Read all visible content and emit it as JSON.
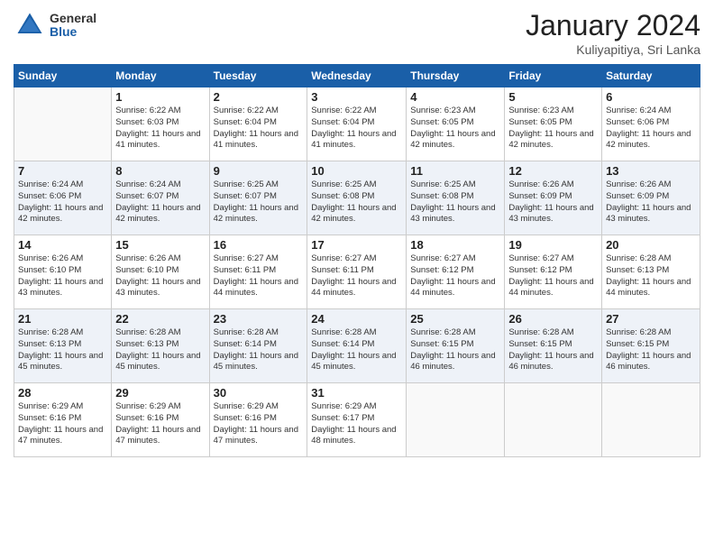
{
  "header": {
    "logo": {
      "general": "General",
      "blue": "Blue"
    },
    "title": "January 2024",
    "subtitle": "Kuliyapitiya, Sri Lanka"
  },
  "calendar": {
    "weekdays": [
      "Sunday",
      "Monday",
      "Tuesday",
      "Wednesday",
      "Thursday",
      "Friday",
      "Saturday"
    ],
    "rows": [
      [
        {
          "day": "",
          "empty": true
        },
        {
          "day": "1",
          "sunrise": "Sunrise: 6:22 AM",
          "sunset": "Sunset: 6:03 PM",
          "daylight": "Daylight: 11 hours and 41 minutes."
        },
        {
          "day": "2",
          "sunrise": "Sunrise: 6:22 AM",
          "sunset": "Sunset: 6:04 PM",
          "daylight": "Daylight: 11 hours and 41 minutes."
        },
        {
          "day": "3",
          "sunrise": "Sunrise: 6:22 AM",
          "sunset": "Sunset: 6:04 PM",
          "daylight": "Daylight: 11 hours and 41 minutes."
        },
        {
          "day": "4",
          "sunrise": "Sunrise: 6:23 AM",
          "sunset": "Sunset: 6:05 PM",
          "daylight": "Daylight: 11 hours and 42 minutes."
        },
        {
          "day": "5",
          "sunrise": "Sunrise: 6:23 AM",
          "sunset": "Sunset: 6:05 PM",
          "daylight": "Daylight: 11 hours and 42 minutes."
        },
        {
          "day": "6",
          "sunrise": "Sunrise: 6:24 AM",
          "sunset": "Sunset: 6:06 PM",
          "daylight": "Daylight: 11 hours and 42 minutes."
        }
      ],
      [
        {
          "day": "7",
          "sunrise": "Sunrise: 6:24 AM",
          "sunset": "Sunset: 6:06 PM",
          "daylight": "Daylight: 11 hours and 42 minutes."
        },
        {
          "day": "8",
          "sunrise": "Sunrise: 6:24 AM",
          "sunset": "Sunset: 6:07 PM",
          "daylight": "Daylight: 11 hours and 42 minutes."
        },
        {
          "day": "9",
          "sunrise": "Sunrise: 6:25 AM",
          "sunset": "Sunset: 6:07 PM",
          "daylight": "Daylight: 11 hours and 42 minutes."
        },
        {
          "day": "10",
          "sunrise": "Sunrise: 6:25 AM",
          "sunset": "Sunset: 6:08 PM",
          "daylight": "Daylight: 11 hours and 42 minutes."
        },
        {
          "day": "11",
          "sunrise": "Sunrise: 6:25 AM",
          "sunset": "Sunset: 6:08 PM",
          "daylight": "Daylight: 11 hours and 43 minutes."
        },
        {
          "day": "12",
          "sunrise": "Sunrise: 6:26 AM",
          "sunset": "Sunset: 6:09 PM",
          "daylight": "Daylight: 11 hours and 43 minutes."
        },
        {
          "day": "13",
          "sunrise": "Sunrise: 6:26 AM",
          "sunset": "Sunset: 6:09 PM",
          "daylight": "Daylight: 11 hours and 43 minutes."
        }
      ],
      [
        {
          "day": "14",
          "sunrise": "Sunrise: 6:26 AM",
          "sunset": "Sunset: 6:10 PM",
          "daylight": "Daylight: 11 hours and 43 minutes."
        },
        {
          "day": "15",
          "sunrise": "Sunrise: 6:26 AM",
          "sunset": "Sunset: 6:10 PM",
          "daylight": "Daylight: 11 hours and 43 minutes."
        },
        {
          "day": "16",
          "sunrise": "Sunrise: 6:27 AM",
          "sunset": "Sunset: 6:11 PM",
          "daylight": "Daylight: 11 hours and 44 minutes."
        },
        {
          "day": "17",
          "sunrise": "Sunrise: 6:27 AM",
          "sunset": "Sunset: 6:11 PM",
          "daylight": "Daylight: 11 hours and 44 minutes."
        },
        {
          "day": "18",
          "sunrise": "Sunrise: 6:27 AM",
          "sunset": "Sunset: 6:12 PM",
          "daylight": "Daylight: 11 hours and 44 minutes."
        },
        {
          "day": "19",
          "sunrise": "Sunrise: 6:27 AM",
          "sunset": "Sunset: 6:12 PM",
          "daylight": "Daylight: 11 hours and 44 minutes."
        },
        {
          "day": "20",
          "sunrise": "Sunrise: 6:28 AM",
          "sunset": "Sunset: 6:13 PM",
          "daylight": "Daylight: 11 hours and 44 minutes."
        }
      ],
      [
        {
          "day": "21",
          "sunrise": "Sunrise: 6:28 AM",
          "sunset": "Sunset: 6:13 PM",
          "daylight": "Daylight: 11 hours and 45 minutes."
        },
        {
          "day": "22",
          "sunrise": "Sunrise: 6:28 AM",
          "sunset": "Sunset: 6:13 PM",
          "daylight": "Daylight: 11 hours and 45 minutes."
        },
        {
          "day": "23",
          "sunrise": "Sunrise: 6:28 AM",
          "sunset": "Sunset: 6:14 PM",
          "daylight": "Daylight: 11 hours and 45 minutes."
        },
        {
          "day": "24",
          "sunrise": "Sunrise: 6:28 AM",
          "sunset": "Sunset: 6:14 PM",
          "daylight": "Daylight: 11 hours and 45 minutes."
        },
        {
          "day": "25",
          "sunrise": "Sunrise: 6:28 AM",
          "sunset": "Sunset: 6:15 PM",
          "daylight": "Daylight: 11 hours and 46 minutes."
        },
        {
          "day": "26",
          "sunrise": "Sunrise: 6:28 AM",
          "sunset": "Sunset: 6:15 PM",
          "daylight": "Daylight: 11 hours and 46 minutes."
        },
        {
          "day": "27",
          "sunrise": "Sunrise: 6:28 AM",
          "sunset": "Sunset: 6:15 PM",
          "daylight": "Daylight: 11 hours and 46 minutes."
        }
      ],
      [
        {
          "day": "28",
          "sunrise": "Sunrise: 6:29 AM",
          "sunset": "Sunset: 6:16 PM",
          "daylight": "Daylight: 11 hours and 47 minutes."
        },
        {
          "day": "29",
          "sunrise": "Sunrise: 6:29 AM",
          "sunset": "Sunset: 6:16 PM",
          "daylight": "Daylight: 11 hours and 47 minutes."
        },
        {
          "day": "30",
          "sunrise": "Sunrise: 6:29 AM",
          "sunset": "Sunset: 6:16 PM",
          "daylight": "Daylight: 11 hours and 47 minutes."
        },
        {
          "day": "31",
          "sunrise": "Sunrise: 6:29 AM",
          "sunset": "Sunset: 6:17 PM",
          "daylight": "Daylight: 11 hours and 48 minutes."
        },
        {
          "day": "",
          "empty": true
        },
        {
          "day": "",
          "empty": true
        },
        {
          "day": "",
          "empty": true
        }
      ]
    ]
  }
}
